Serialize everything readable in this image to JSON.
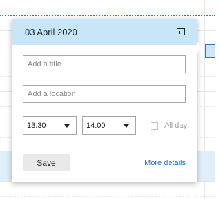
{
  "popup": {
    "date": "03 April 2020",
    "title_field": {
      "value": "",
      "placeholder": "Add a title"
    },
    "location_field": {
      "value": "",
      "placeholder": "Add a location"
    },
    "start_time": "13:30",
    "end_time": "14:00",
    "all_day_label": "All day",
    "all_day_checked": false,
    "save_label": "Save",
    "more_details_label": "More details"
  },
  "icons": {
    "header_action": "expand-window-icon",
    "dropdown": "chevron-down-icon"
  },
  "colors": {
    "header_bg": "#c8e6f8",
    "link": "#1e6fc9",
    "current_time_line": "#1e7bd6",
    "selection_band": "#dfeef9"
  }
}
